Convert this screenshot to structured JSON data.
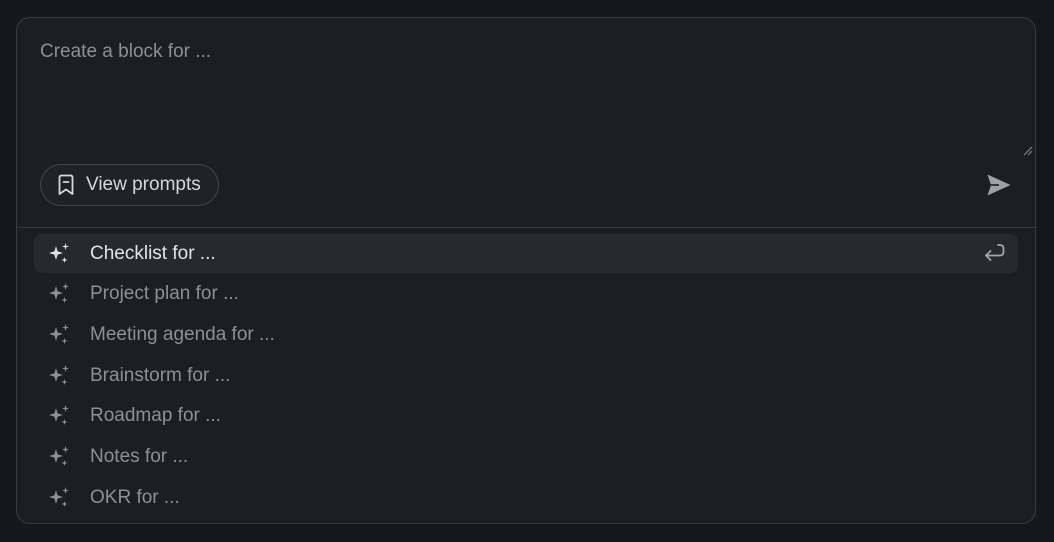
{
  "prompt": {
    "placeholder": "Create a block for ...",
    "value": ""
  },
  "buttons": {
    "view_prompts": "View prompts",
    "send_icon": "send-icon"
  },
  "suggestions": [
    {
      "label": "Checklist for ...",
      "active": true
    },
    {
      "label": "Project plan for ...",
      "active": false
    },
    {
      "label": "Meeting agenda for ...",
      "active": false
    },
    {
      "label": "Brainstorm for ...",
      "active": false
    },
    {
      "label": "Roadmap for ...",
      "active": false
    },
    {
      "label": "Notes for ...",
      "active": false
    },
    {
      "label": "OKR for ...",
      "active": false
    }
  ],
  "icons": {
    "suggestion": "sparkles-icon",
    "active_hint": "enter-icon",
    "view_prompts": "bookmark-icon"
  },
  "colors": {
    "background": "#16181a",
    "panel": "#1c1e21",
    "active_row": "#27292d",
    "text_active": "#e3e4e6",
    "text_muted": "#8d9095"
  }
}
